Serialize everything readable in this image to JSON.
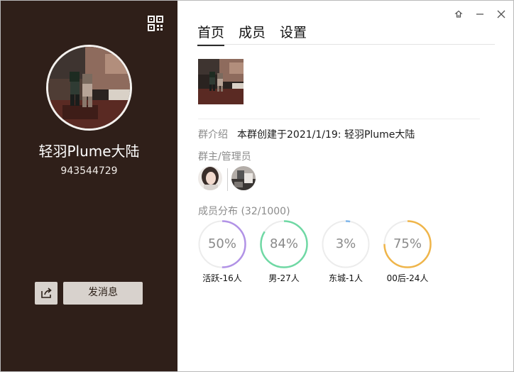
{
  "group": {
    "name": "轻羽Plume大陆",
    "id": "943544729"
  },
  "sidebar": {
    "send_label": "发消息"
  },
  "tabs": [
    {
      "label": "首页",
      "active": true
    },
    {
      "label": "成员",
      "active": false
    },
    {
      "label": "设置",
      "active": false
    }
  ],
  "intro": {
    "label": "群介绍",
    "text": "本群创建于2021/1/19:  轻羽Plume大陆"
  },
  "admins": {
    "label": "群主/管理员"
  },
  "distribution": {
    "label": "成员分布 (32/1000)",
    "stats": [
      {
        "pct": "50%",
        "value": 0.5,
        "caption": "活跃-16人",
        "color": "#b192e6"
      },
      {
        "pct": "84%",
        "value": 0.84,
        "caption": "男-27人",
        "color": "#6fd8a4"
      },
      {
        "pct": "3%",
        "value": 0.03,
        "caption": "东城-1人",
        "color": "#7fb6ea"
      },
      {
        "pct": "75%",
        "value": 0.75,
        "caption": "00后-24人",
        "color": "#efb54a"
      }
    ]
  },
  "colors": {
    "sidebar_bg": "#2f1f19",
    "track": "#ececec"
  }
}
